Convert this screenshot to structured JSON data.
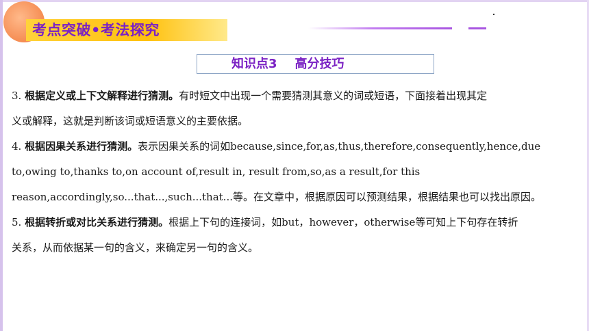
{
  "header": {
    "title": "考点突破•考法探究"
  },
  "knowledge_point": {
    "label": "知识点3",
    "topic": "高分技巧"
  },
  "content": {
    "item3": {
      "num": "3. ",
      "heading": "根据定义或上下文解释进行猜测。",
      "text_a": "有时短文中出现一个需要猜测其意义的词或短语，下面接着出现其定",
      "text_b": "义或解释，这就是判断该词或短语意义的主要依据。"
    },
    "item4": {
      "num": "4. ",
      "heading": "根据因果关系进行猜测。",
      "text_a_cjk": "表示因果关系的词如",
      "text_a_en": "because,since,for,as,thus,therefore,consequently,hence,due",
      "text_b": "to,owing to,thanks to,on account of,result in, result from,so,as a result,for this",
      "text_c_en": "reason,accordingly,so...that...,such...that...",
      "text_c_cjk": "等。在文章中，根据原因可以预测结果，根据结果也可以找出原因。"
    },
    "item5": {
      "num": "5. ",
      "heading": "根据转折或对比关系进行猜测。",
      "text_a_cjk1": "根据上下句的连接词，如",
      "text_a_en1": "but",
      "text_a_sep": "，",
      "text_a_en2": "however",
      "text_a_sep2": "，",
      "text_a_en3": "otherwise",
      "text_a_cjk2": "等可知上下句存在转折",
      "text_b": "关系，从而依据某一句的含义，来确定另一句的含义。"
    }
  }
}
